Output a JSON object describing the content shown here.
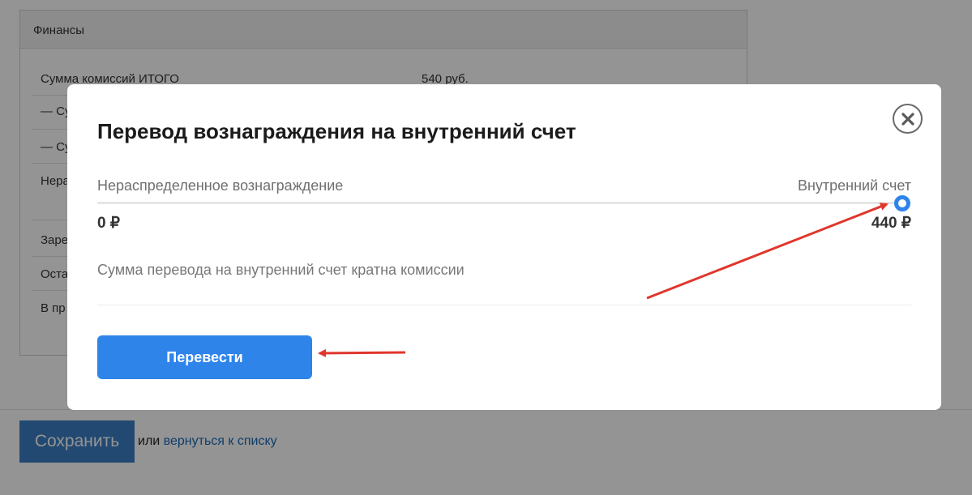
{
  "finance": {
    "header": "Финансы",
    "rows": [
      {
        "label": "Сумма комиссий ИТОГО",
        "value": "540 руб."
      },
      {
        "label": "— Су",
        "value": ""
      },
      {
        "label": "— Су",
        "value": ""
      },
      {
        "label": "Нера",
        "value": ""
      },
      {
        "label": "Заре",
        "value": ""
      },
      {
        "label": "Оста",
        "value": ""
      },
      {
        "label": "В пр",
        "value": ""
      }
    ]
  },
  "footer": {
    "save_label": "Сохранить",
    "or_text": "или",
    "back_link": "вернуться к списку"
  },
  "modal": {
    "title": "Перевод вознаграждения на внутренний счет",
    "left_label": "Нераспределенное вознаграждение",
    "right_label": "Внутренний счет",
    "left_amount": "0 ₽",
    "right_amount": "440 ₽",
    "slider_fraction": 1.0,
    "note": "Сумма перевода на внутренний счет кратна комиссии",
    "submit_label": "Перевести",
    "close_icon": "close-icon"
  },
  "colors": {
    "accent": "#2f84ea",
    "save_button": "#3c7fc4",
    "link": "#1a6bb8",
    "annotation_arrow": "#e0362c"
  }
}
